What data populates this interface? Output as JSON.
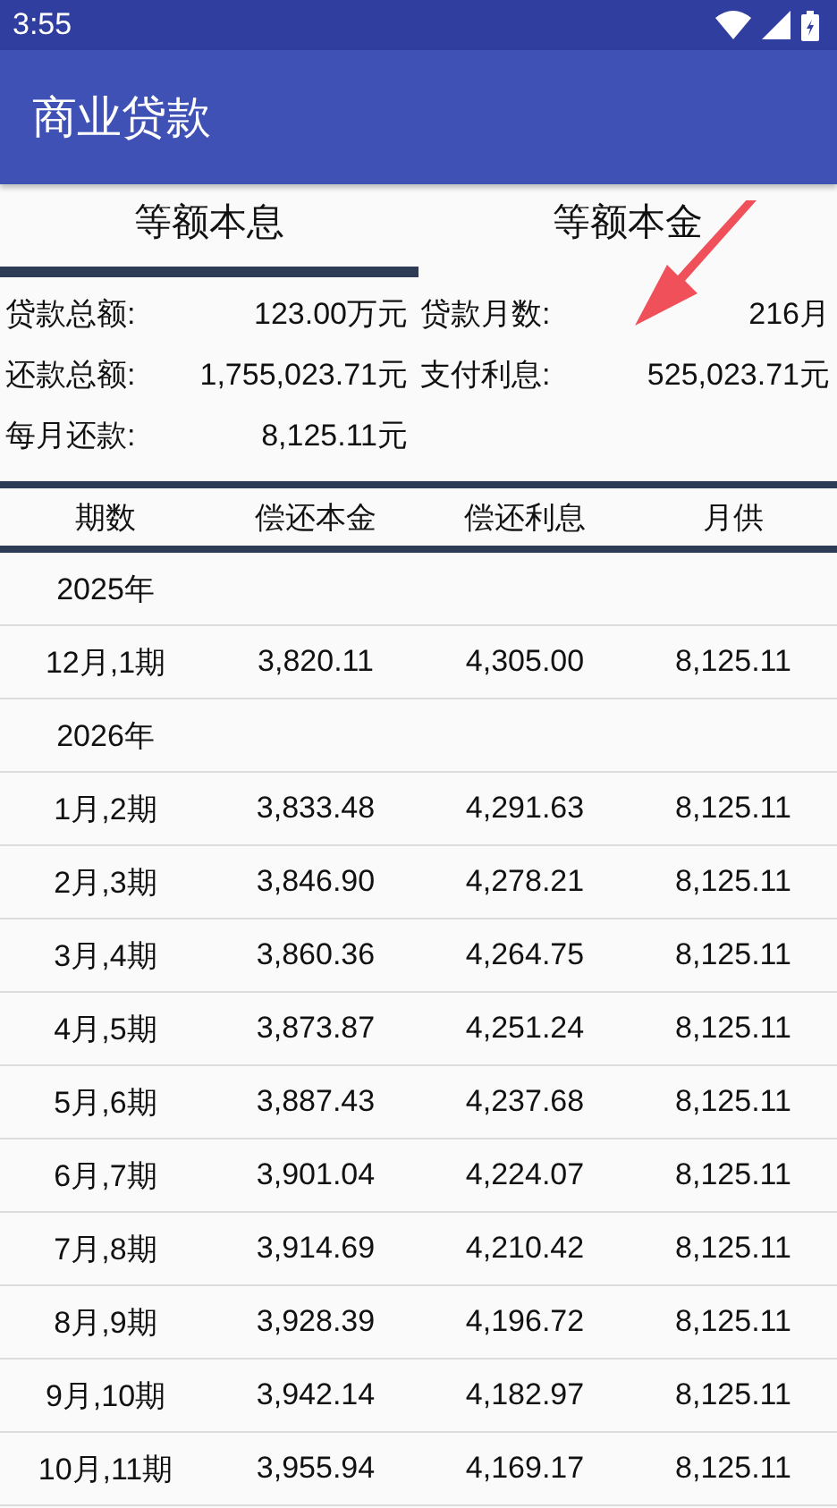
{
  "status_bar": {
    "time": "3:55"
  },
  "app_bar": {
    "title": "商业贷款"
  },
  "tabs": [
    {
      "label": "等额本息",
      "selected": true
    },
    {
      "label": "等额本金",
      "selected": false
    }
  ],
  "summary": [
    [
      {
        "label": "贷款总额:",
        "value": "123.00万元"
      },
      {
        "label": "贷款月数:",
        "value": "216月"
      }
    ],
    [
      {
        "label": "还款总额:",
        "value": "1,755,023.71元"
      },
      {
        "label": "支付利息:",
        "value": "525,023.71元"
      }
    ],
    [
      {
        "label": "每月还款:",
        "value": "8,125.11元"
      }
    ]
  ],
  "table": {
    "columns": [
      "期数",
      "偿还本金",
      "偿还利息",
      "月供"
    ],
    "rows": [
      {
        "kind": "year",
        "cells": [
          "2025年"
        ]
      },
      {
        "kind": "period",
        "cells": [
          "12月,1期",
          "3,820.11",
          "4,305.00",
          "8,125.11"
        ]
      },
      {
        "kind": "year",
        "cells": [
          "2026年"
        ]
      },
      {
        "kind": "period",
        "cells": [
          "1月,2期",
          "3,833.48",
          "4,291.63",
          "8,125.11"
        ]
      },
      {
        "kind": "period",
        "cells": [
          "2月,3期",
          "3,846.90",
          "4,278.21",
          "8,125.11"
        ]
      },
      {
        "kind": "period",
        "cells": [
          "3月,4期",
          "3,860.36",
          "4,264.75",
          "8,125.11"
        ]
      },
      {
        "kind": "period",
        "cells": [
          "4月,5期",
          "3,873.87",
          "4,251.24",
          "8,125.11"
        ]
      },
      {
        "kind": "period",
        "cells": [
          "5月,6期",
          "3,887.43",
          "4,237.68",
          "8,125.11"
        ]
      },
      {
        "kind": "period",
        "cells": [
          "6月,7期",
          "3,901.04",
          "4,224.07",
          "8,125.11"
        ]
      },
      {
        "kind": "period",
        "cells": [
          "7月,8期",
          "3,914.69",
          "4,210.42",
          "8,125.11"
        ]
      },
      {
        "kind": "period",
        "cells": [
          "8月,9期",
          "3,928.39",
          "4,196.72",
          "8,125.11"
        ]
      },
      {
        "kind": "period",
        "cells": [
          "9月,10期",
          "3,942.14",
          "4,182.97",
          "8,125.11"
        ]
      },
      {
        "kind": "period",
        "cells": [
          "10月,11期",
          "3,955.94",
          "4,169.17",
          "8,125.11"
        ]
      }
    ]
  }
}
